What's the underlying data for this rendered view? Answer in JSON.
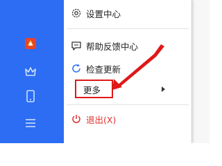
{
  "colors": {
    "sidebar": "#2c6df4",
    "accent_red": "#e01818",
    "exit_text": "#e03030",
    "menu_text": "#222222"
  },
  "sidebar": {
    "icons": [
      "app-logo-icon",
      "crown-icon",
      "phone-icon",
      "menu-lines-icon"
    ]
  },
  "menu": {
    "settings": {
      "label": "设置中心",
      "icon": "gear-icon"
    },
    "feedback": {
      "label": "帮助反馈中心",
      "icon": "chat-bubble-icon"
    },
    "update": {
      "label": "检查更新",
      "icon": "refresh-icon"
    },
    "more": {
      "label": "更多",
      "icon": "chevron-right-icon"
    },
    "exit": {
      "label": "退出(X)",
      "icon": "power-icon"
    }
  }
}
